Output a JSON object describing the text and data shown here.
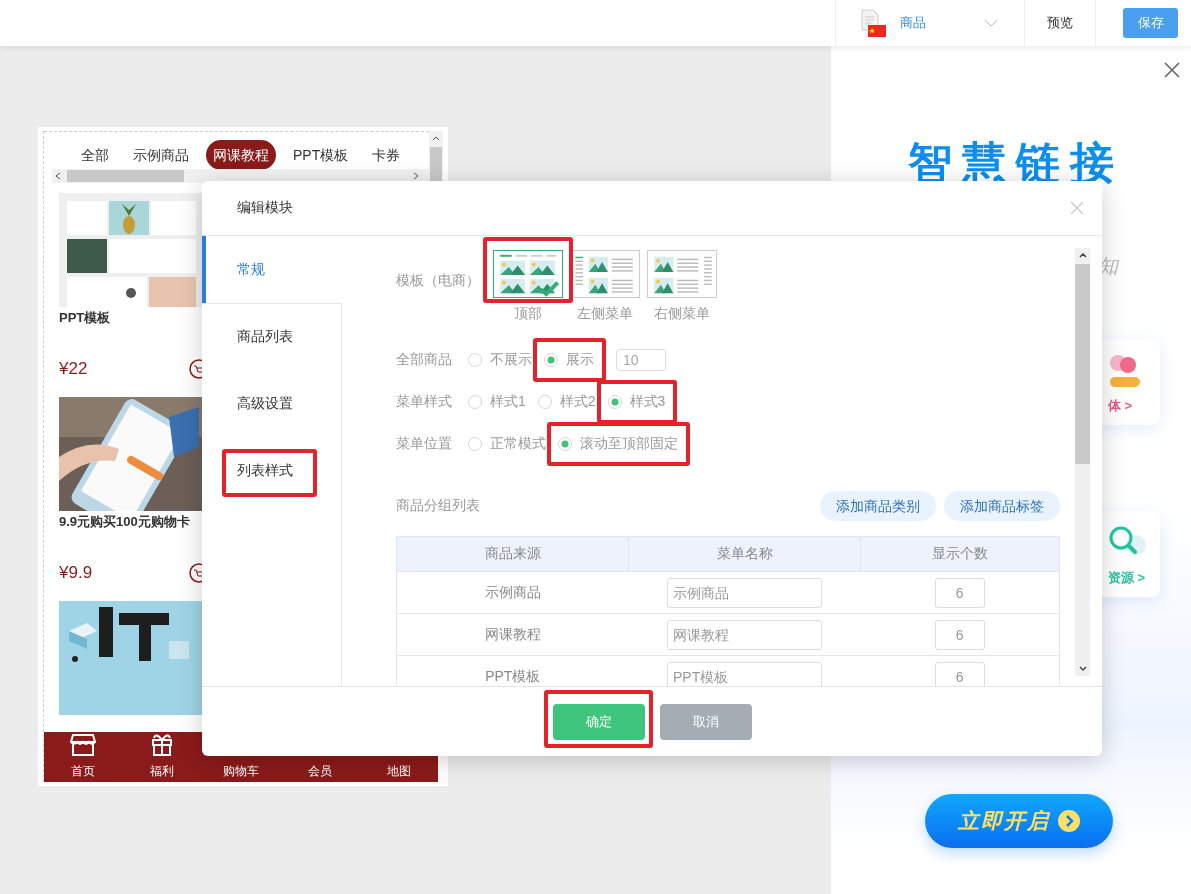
{
  "top_bar": {
    "page_select": "商品",
    "preview_button": "预览",
    "save_button": "保存"
  },
  "phone_preview": {
    "tabs": [
      {
        "label": "全部",
        "selected": false
      },
      {
        "label": "示例商品",
        "selected": false
      },
      {
        "label": "网课教程",
        "selected": true
      },
      {
        "label": "PPT模板",
        "selected": false
      },
      {
        "label": "卡券",
        "selected": false
      }
    ],
    "products": [
      {
        "kind": "full",
        "title": "PPT模板",
        "price": "¥22"
      },
      {
        "kind": "full",
        "title": "9.9元购买100元购物卡",
        "price": "¥9.9"
      },
      {
        "kind": "image-only"
      }
    ],
    "bottom_nav": [
      "首页",
      "福利",
      "购物车",
      "会员",
      "地图"
    ]
  },
  "side_panel": {
    "title": "智慧链接",
    "text_fragment": "知",
    "cards": [
      {
        "kind": "media",
        "label": "体 >",
        "color": "#e95a86"
      },
      {
        "kind": "search",
        "label": "资源 >",
        "color": "#2bbf9c"
      }
    ],
    "cta_button": "立即开启"
  },
  "dialog": {
    "title": "编辑模块",
    "nav": [
      {
        "label": "常规",
        "selected": true,
        "highlighted": false
      },
      {
        "label": "商品列表",
        "selected": false,
        "highlighted": false
      },
      {
        "label": "高级设置",
        "selected": false,
        "highlighted": false
      },
      {
        "label": "列表样式",
        "selected": false,
        "highlighted": true
      }
    ],
    "template": {
      "label": "模板（电商）",
      "options": [
        {
          "kind": "top",
          "caption": "顶部",
          "selected": true,
          "highlighted": true
        },
        {
          "kind": "left",
          "caption": "左侧菜单",
          "selected": false,
          "highlighted": false
        },
        {
          "kind": "right",
          "caption": "右侧菜单",
          "selected": false,
          "highlighted": false
        }
      ]
    },
    "settings": [
      {
        "label": "全部商品",
        "options": [
          {
            "label": "不展示",
            "selected": false,
            "highlighted": false
          },
          {
            "label": "展示",
            "selected": true,
            "highlighted": true
          }
        ],
        "count": "10"
      },
      {
        "label": "菜单样式",
        "options": [
          {
            "label": "样式1",
            "selected": false,
            "highlighted": false
          },
          {
            "label": "样式2",
            "selected": false,
            "highlighted": false
          },
          {
            "label": "样式3",
            "selected": true,
            "highlighted": true
          }
        ]
      },
      {
        "label": "菜单位置",
        "options": [
          {
            "label": "正常模式",
            "selected": false,
            "highlighted": false
          },
          {
            "label": "滚动至顶部固定",
            "selected": true,
            "highlighted": true
          }
        ]
      }
    ],
    "group_list": {
      "label": "商品分组列表",
      "buttons": [
        "添加商品类别",
        "添加商品标签"
      ],
      "columns": [
        "商品来源",
        "菜单名称",
        "显示个数"
      ],
      "rows": [
        {
          "source": "示例商品",
          "menu_name": "示例商品",
          "count": "6"
        },
        {
          "source": "网课教程",
          "menu_name": "网课教程",
          "count": "6"
        },
        {
          "source": "PPT模板",
          "menu_name": "PPT模板",
          "count": "6"
        }
      ]
    },
    "footer_buttons": [
      {
        "kind": "primary",
        "label": "确定",
        "highlighted": true
      },
      {
        "kind": "secondary",
        "label": "取消",
        "highlighted": false
      }
    ]
  }
}
